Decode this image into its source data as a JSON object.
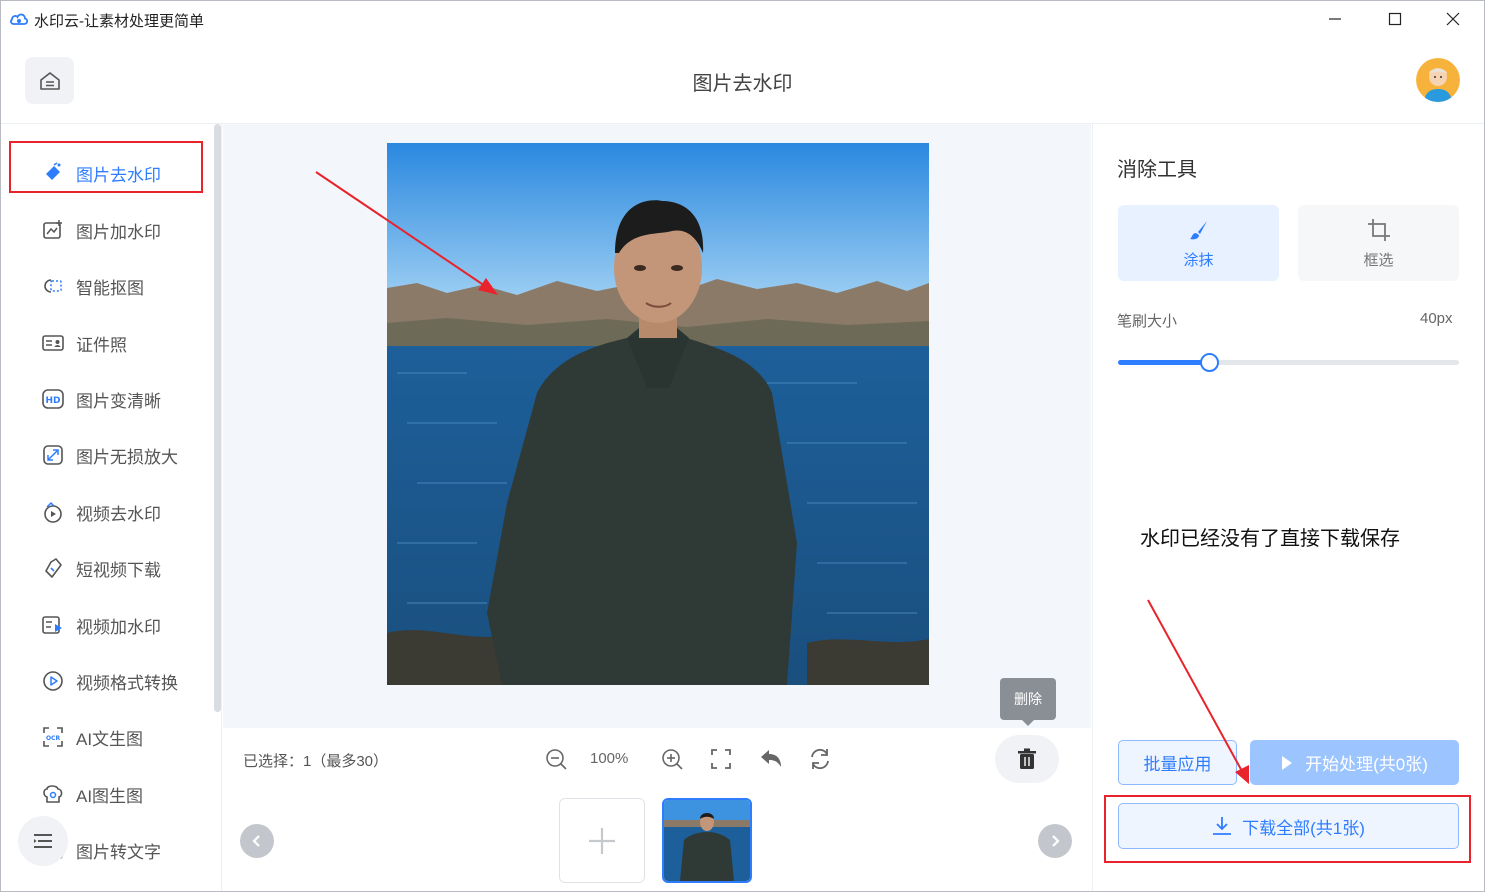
{
  "window": {
    "title": "水印云-让素材处理更简单",
    "controls": [
      "minimize-icon",
      "maximize-icon",
      "close-icon"
    ]
  },
  "header": {
    "home_icon": "home-icon",
    "page_title": "图片去水印"
  },
  "sidebar": {
    "items": [
      {
        "label": "图片去水印",
        "icon": "eraser-icon",
        "active": true
      },
      {
        "label": "图片加水印",
        "icon": "image-add-icon",
        "active": false
      },
      {
        "label": "智能抠图",
        "icon": "cutout-icon",
        "active": false
      },
      {
        "label": "证件照",
        "icon": "id-card-icon",
        "active": false
      },
      {
        "label": "图片变清晰",
        "icon": "hd-icon",
        "active": false
      },
      {
        "label": "图片无损放大",
        "icon": "enlarge-icon",
        "active": false
      },
      {
        "label": "视频去水印",
        "icon": "video-erase-icon",
        "active": false
      },
      {
        "label": "短视频下载",
        "icon": "link-download-icon",
        "active": false
      },
      {
        "label": "视频加水印",
        "icon": "video-add-icon",
        "active": false
      },
      {
        "label": "视频格式转换",
        "icon": "play-circle-icon",
        "active": false
      },
      {
        "label": "AI文生图",
        "icon": "ocr-icon",
        "active": false
      },
      {
        "label": "AI图生图",
        "icon": "ai-image-icon",
        "active": false
      },
      {
        "label": "图片转文字",
        "icon": "image-text-icon",
        "active": false
      }
    ],
    "menu_icon": "menu-icon"
  },
  "toolbar": {
    "selection_text": "已选择：1（最多30）",
    "zoom_level": "100%",
    "delete_tooltip": "删除",
    "icons": [
      "zoom-out-icon",
      "zoom-in-icon",
      "fullscreen-icon",
      "undo-icon",
      "reset-icon",
      "trash-icon"
    ]
  },
  "thumbnails": {
    "count": 1,
    "add_icon": "plus-icon"
  },
  "right_panel": {
    "title": "消除工具",
    "tools": [
      {
        "label": "涂抹",
        "icon": "brush-icon",
        "selected": true
      },
      {
        "label": "框选",
        "icon": "crop-icon",
        "selected": false
      }
    ],
    "brush_size_label": "笔刷大小",
    "brush_size_value": "40px",
    "brush_fraction": 0.27,
    "annotation": "水印已经没有了直接下载保存",
    "batch_button": "批量应用",
    "start_button": "开始处理(共0张)",
    "download_button": "下载全部(共1张)"
  },
  "colors": {
    "accent": "#2f7dff",
    "highlight_red": "#e8232b",
    "canvas_bg": "#f3f6fa"
  }
}
